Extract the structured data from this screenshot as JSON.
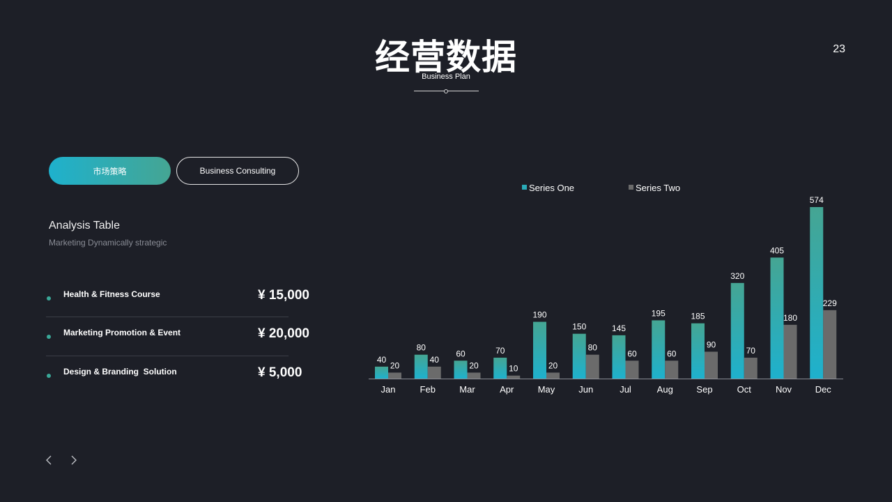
{
  "header": {
    "title": "经营数据",
    "subtitle": "Business Plan",
    "page_number": "23"
  },
  "tabs": [
    {
      "label": "市场策略",
      "active": true
    },
    {
      "label": "Business Consulting",
      "active": false
    }
  ],
  "analysis": {
    "title": "Analysis Table",
    "subtitle": "Marketing Dynamically strategic",
    "items": [
      {
        "label": "Health & Fitness Course",
        "price": "¥ 15,000"
      },
      {
        "label": "Marketing Promotion & Event",
        "price": "¥ 20,000"
      },
      {
        "label": "Design & Branding  Solution",
        "price": "¥ 5,000"
      }
    ]
  },
  "nav": {
    "prev_icon": "chevron-left-icon",
    "next_icon": "chevron-right-icon"
  },
  "colors": {
    "background": "#1d1f27",
    "accent_start": "#1eb1cd",
    "accent_end": "#45a593",
    "series_two": "#6b6b6b"
  },
  "chart_data": {
    "type": "bar",
    "categories": [
      "Jan",
      "Feb",
      "Mar",
      "Apr",
      "May",
      "Jun",
      "Jul",
      "Aug",
      "Sep",
      "Oct",
      "Nov",
      "Dec"
    ],
    "series": [
      {
        "name": "Series One",
        "values": [
          40,
          80,
          60,
          70,
          190,
          150,
          145,
          195,
          185,
          320,
          405,
          574
        ]
      },
      {
        "name": "Series Two",
        "values": [
          20,
          40,
          20,
          10,
          20,
          80,
          60,
          60,
          90,
          70,
          180,
          229
        ]
      }
    ],
    "ylim": [
      0,
      574
    ],
    "grid": false,
    "legend": "top-left",
    "data_labels": true
  }
}
